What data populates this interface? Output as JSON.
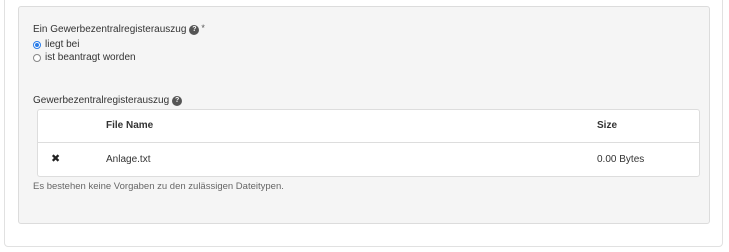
{
  "question": {
    "label": "Ein Gewerbezentralregisterauszug",
    "required_mark": "*",
    "help_icon": "question-circle-icon"
  },
  "options": [
    {
      "label": "liegt bei",
      "checked": true
    },
    {
      "label": "ist beantragt worden",
      "checked": false
    }
  ],
  "upload": {
    "label": "Gewerbezentralregisterauszug",
    "help_icon": "question-circle-icon",
    "columns": {
      "name": "File Name",
      "size": "Size"
    },
    "files": [
      {
        "remove_icon": "close-icon",
        "remove_glyph": "✖",
        "name": "Anlage.txt",
        "size": "0.00 Bytes"
      }
    ],
    "hint": "Es bestehen keine Vorgaben zu den zulässigen Dateitypen."
  },
  "colors": {
    "accent": "#2b7de9",
    "panel_bg": "#f5f5f5"
  }
}
